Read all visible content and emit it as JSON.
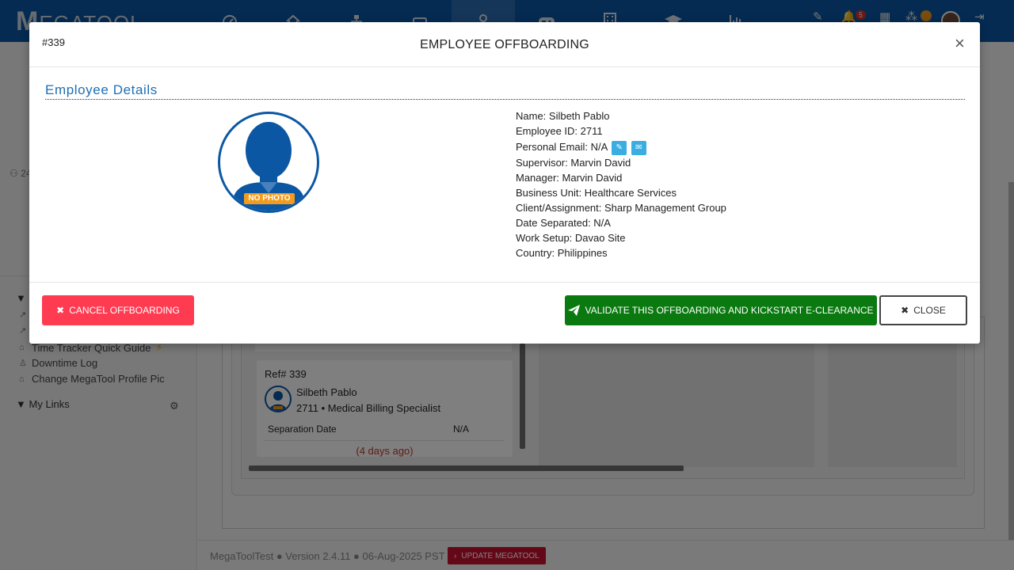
{
  "app": {
    "logo_text": "MEGATOOL",
    "logo_visible": "M",
    "nav_icons": [
      "dashboard-icon",
      "home-icon",
      "org-chart-icon",
      "drive-icon",
      "user-icon",
      "gamepad-icon",
      "building-icon",
      "graduation-cap-icon",
      "bar-chart-icon"
    ],
    "active_nav": "user-icon",
    "notifications_count": "5",
    "accent_color": "#0b57a4"
  },
  "sidebar": {
    "meta_text": "24",
    "links": [
      {
        "label": "Time Tracker Quick Guide",
        "icon": "lock-icon",
        "suffix": "⚡"
      },
      {
        "label": "Downtime Log",
        "icon": "person-icon"
      },
      {
        "label": "Change MegaTool Profile Pic",
        "icon": "lock-icon"
      }
    ],
    "my_links_label": "My Links"
  },
  "board": {
    "card": {
      "ref": "Ref# 339",
      "name": "Silbeth Pablo",
      "subtitle": "2711 • Medical Billing Specialist",
      "field_label": "Separation Date",
      "field_value": "N/A",
      "relative_time": "(4 days ago)"
    }
  },
  "footer": {
    "version_text": "MegaToolTest ● Version 2.4.11 ● 06-Aug-2025 PST",
    "update_label": "UPDATE MEGATOOL"
  },
  "modal": {
    "ticket_id": "#339",
    "title": "EMPLOYEE OFFBOARDING",
    "close_glyph": "×",
    "section_title": "Employee Details",
    "photo_label": "NO PHOTO",
    "details": {
      "name": "Name: Silbeth Pablo",
      "employee_id": "Employee ID: 2711",
      "personal_email": "Personal Email: N/A",
      "supervisor": "Supervisor: Marvin David",
      "manager": "Manager: Marvin David",
      "business_unit": "Business Unit: Healthcare Services",
      "client": "Client/Assignment: Sharp Management Group",
      "date_separated": "Date Separated: N/A",
      "work_setup": "Work Setup: Davao Site",
      "country": "Country: Philippines"
    },
    "buttons": {
      "cancel_label": "CANCEL OFFBOARDING",
      "validate_label": "VALIDATE THIS OFFBOARDING AND KICKSTART E-CLEARANCE",
      "close_label": "CLOSE"
    },
    "colors": {
      "cancel": "#ff3b52",
      "validate": "#0a7a10",
      "title_blue": "#1d6fb5"
    }
  }
}
